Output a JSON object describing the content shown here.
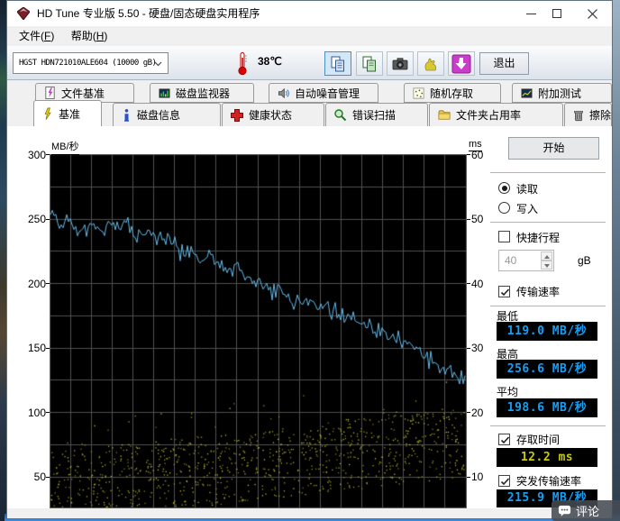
{
  "window": {
    "title": "HD Tune 专业版 5.50 - 硬盘/固态硬盘实用程序"
  },
  "menu": {
    "file": {
      "pre": "文件(",
      "key": "F",
      "suf": ")"
    },
    "help": {
      "pre": "帮助(",
      "key": "H",
      "suf": ")"
    }
  },
  "toolbar": {
    "drive": "HGST HDN721010ALE604 (10000 gB)",
    "temperature": "38℃",
    "exit_label": "退出"
  },
  "tabs": {
    "row1": [
      {
        "label": "文件基准"
      },
      {
        "label": "磁盘监视器"
      },
      {
        "label": "自动噪音管理"
      },
      {
        "label": "随机存取"
      },
      {
        "label": "附加测试"
      }
    ],
    "row2": [
      {
        "label": "基准",
        "selected": true
      },
      {
        "label": "磁盘信息"
      },
      {
        "label": "健康状态"
      },
      {
        "label": "错误扫描"
      },
      {
        "label": "文件夹占用率"
      },
      {
        "label": "擦除"
      }
    ]
  },
  "panel": {
    "start_label": "开始",
    "read_label": "读取",
    "write_label": "写入",
    "short_stroke_label": "快捷行程",
    "capacity_value": "40",
    "capacity_unit": "gB",
    "transfer_label": "传输速率",
    "min_label": "最低",
    "min_value": "119.0 MB/秒",
    "max_label": "最高",
    "max_value": "256.6 MB/秒",
    "avg_label": "平均",
    "avg_value": "198.6 MB/秒",
    "access_label": "存取时间",
    "access_value": "12.2 ms",
    "burst_label": "突发传输速率",
    "burst_value": "215.9 MB/秒"
  },
  "comment_badge": "评论",
  "chart_data": {
    "type": "line+scatter",
    "left_axis": {
      "label": "MB/秒",
      "ticks": [
        300,
        250,
        200,
        150,
        100,
        50
      ],
      "range": [
        0,
        300
      ]
    },
    "right_axis": {
      "label": "ms",
      "ticks": [
        60,
        50,
        40,
        30,
        20,
        10
      ],
      "range": [
        0,
        60
      ]
    },
    "grid": {
      "v_divisions": 20,
      "h_step_units": 25
    },
    "transfer_series": {
      "name": "读取传输速率",
      "color": "#66bbe8",
      "noise_amp": 7.5,
      "seed": 11,
      "points": [
        [
          0.0,
          253
        ],
        [
          0.01,
          258
        ],
        [
          0.02,
          244
        ],
        [
          0.04,
          251
        ],
        [
          0.06,
          238
        ],
        [
          0.08,
          242
        ],
        [
          0.1,
          247
        ],
        [
          0.12,
          240
        ],
        [
          0.14,
          246
        ],
        [
          0.16,
          243
        ],
        [
          0.18,
          247
        ],
        [
          0.2,
          242
        ],
        [
          0.22,
          236
        ],
        [
          0.24,
          240
        ],
        [
          0.26,
          234
        ],
        [
          0.28,
          237
        ],
        [
          0.3,
          228
        ],
        [
          0.32,
          221
        ],
        [
          0.34,
          226
        ],
        [
          0.36,
          218
        ],
        [
          0.38,
          223
        ],
        [
          0.4,
          215
        ],
        [
          0.42,
          211
        ],
        [
          0.44,
          214
        ],
        [
          0.46,
          208
        ],
        [
          0.48,
          205
        ],
        [
          0.5,
          202
        ],
        [
          0.52,
          199
        ],
        [
          0.54,
          196
        ],
        [
          0.56,
          193
        ],
        [
          0.58,
          190
        ],
        [
          0.6,
          188
        ],
        [
          0.62,
          186
        ],
        [
          0.64,
          184
        ],
        [
          0.66,
          181
        ],
        [
          0.68,
          178
        ],
        [
          0.7,
          175
        ],
        [
          0.72,
          173
        ],
        [
          0.74,
          171
        ],
        [
          0.76,
          168
        ],
        [
          0.78,
          165
        ],
        [
          0.8,
          162
        ],
        [
          0.82,
          159
        ],
        [
          0.84,
          157
        ],
        [
          0.86,
          153
        ],
        [
          0.88,
          149
        ],
        [
          0.9,
          145
        ],
        [
          0.92,
          140
        ],
        [
          0.94,
          136
        ],
        [
          0.96,
          131
        ],
        [
          0.98,
          127
        ],
        [
          1.0,
          124
        ]
      ]
    },
    "access_scatter": {
      "name": "存取时间",
      "color": "#c9c92c",
      "count": 980,
      "ms_base_start": 8.3,
      "ms_base_end": 15.5,
      "ms_jitter": 5.5,
      "outlier_rate": 0.09,
      "outlier_extra_ms": 7,
      "seed": 7
    }
  }
}
